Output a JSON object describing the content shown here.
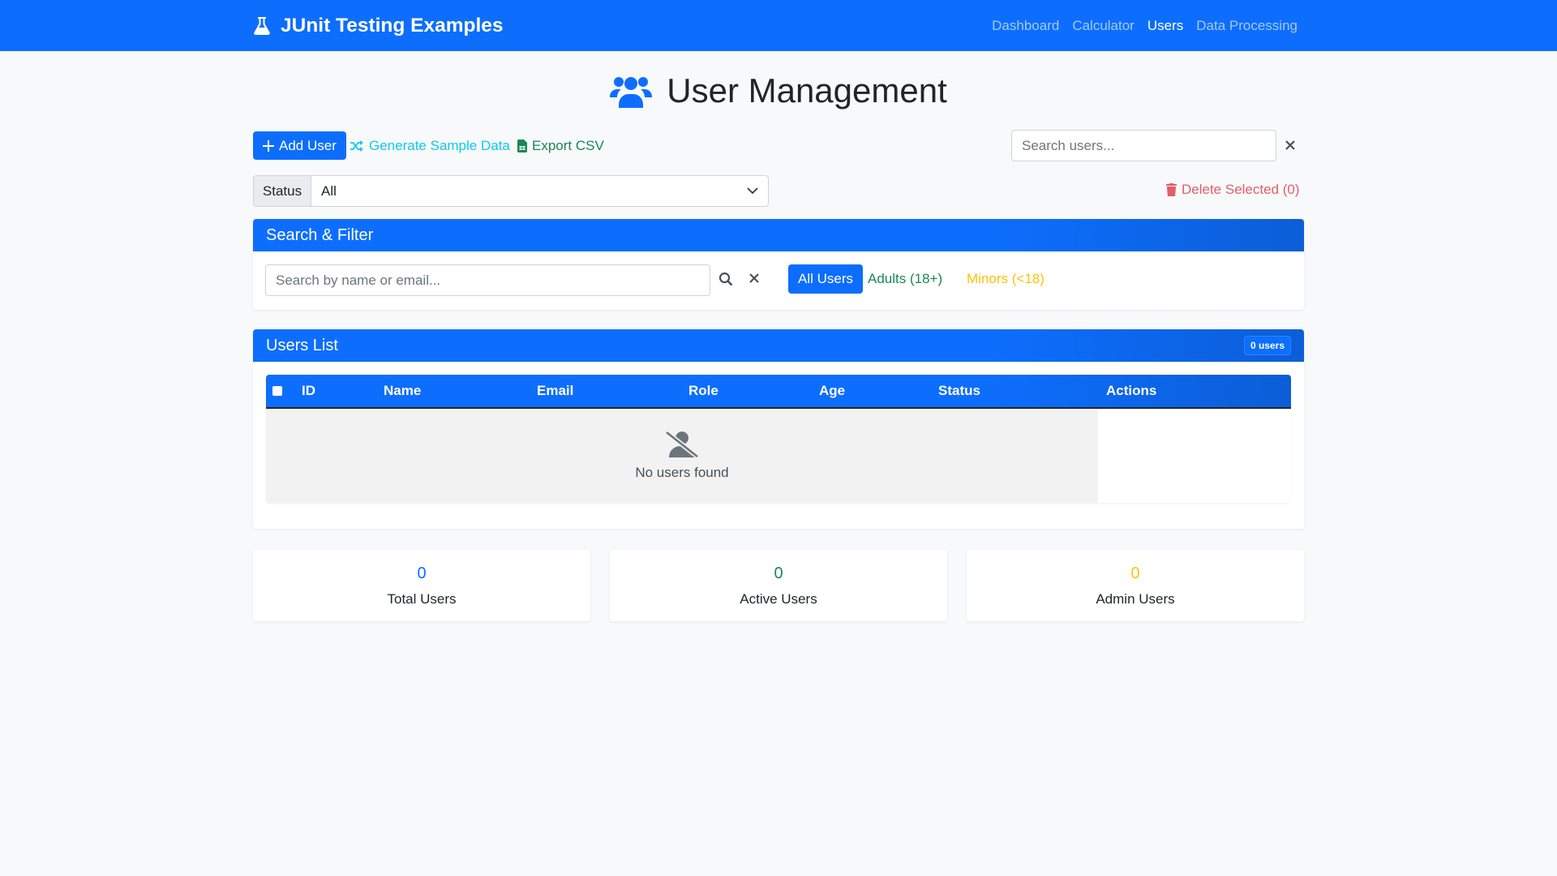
{
  "navbar": {
    "brand": "JUnit Testing Examples",
    "brand_icon": "flask-icon",
    "links": [
      {
        "label": "Dashboard",
        "active": false
      },
      {
        "label": "Calculator",
        "active": false
      },
      {
        "label": "Users",
        "active": true
      },
      {
        "label": "Data Processing",
        "active": false
      }
    ]
  },
  "page": {
    "title": "User Management",
    "title_icon": "users-icon"
  },
  "toolbar": {
    "add_user": "Add User",
    "generate_sample": "Generate Sample Data",
    "export_csv": "Export CSV",
    "search_placeholder": "Search users...",
    "search_value": "",
    "status_label": "Status",
    "status_value": "All",
    "delete_selected": "Delete Selected (0)"
  },
  "filter": {
    "title": "Search & Filter",
    "search_placeholder": "Search by name or email...",
    "search_value": "",
    "segments": {
      "all": "All Users",
      "adults": "Adults (18+)",
      "minors": "Minors (<18)"
    },
    "active_segment": "all"
  },
  "users_list": {
    "title": "Users List",
    "count_badge": "0 users",
    "columns": [
      "ID",
      "Name",
      "Email",
      "Role",
      "Age",
      "Status",
      "Actions"
    ],
    "rows": [],
    "empty_message": "No users found"
  },
  "stats": [
    {
      "value": "0",
      "label": "Total Users",
      "color": "#0d6efd"
    },
    {
      "value": "0",
      "label": "Active Users",
      "color": "#198754"
    },
    {
      "value": "0",
      "label": "Admin Users",
      "color": "#ffc107"
    }
  ],
  "colors": {
    "primary": "#0d6efd",
    "info": "#0dcaf0",
    "success": "#198754",
    "warning": "#ffc107",
    "danger": "#e35d6a",
    "background": "#f8f9fa"
  }
}
